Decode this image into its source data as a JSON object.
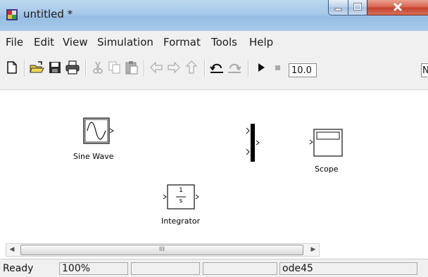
{
  "window": {
    "title": "untitled *"
  },
  "menu": [
    "File",
    "Edit",
    "View",
    "Simulation",
    "Format",
    "Tools",
    "Help"
  ],
  "toolbar": {
    "stop_time": "10.0",
    "clipped_field": "N"
  },
  "blocks": {
    "sine_wave": {
      "label": "Sine Wave"
    },
    "scope": {
      "label": "Scope"
    },
    "integrator": {
      "label": "Integrator",
      "numerator": "1",
      "denominator": "s"
    }
  },
  "scrollbar": {
    "grip": "III"
  },
  "status": {
    "state": "Ready",
    "zoom": "100%",
    "solver": "ode45"
  },
  "colors": {
    "titlebar": "#a6c8e8",
    "close_button": "#c4402a",
    "chrome": "#f0f0f0"
  }
}
